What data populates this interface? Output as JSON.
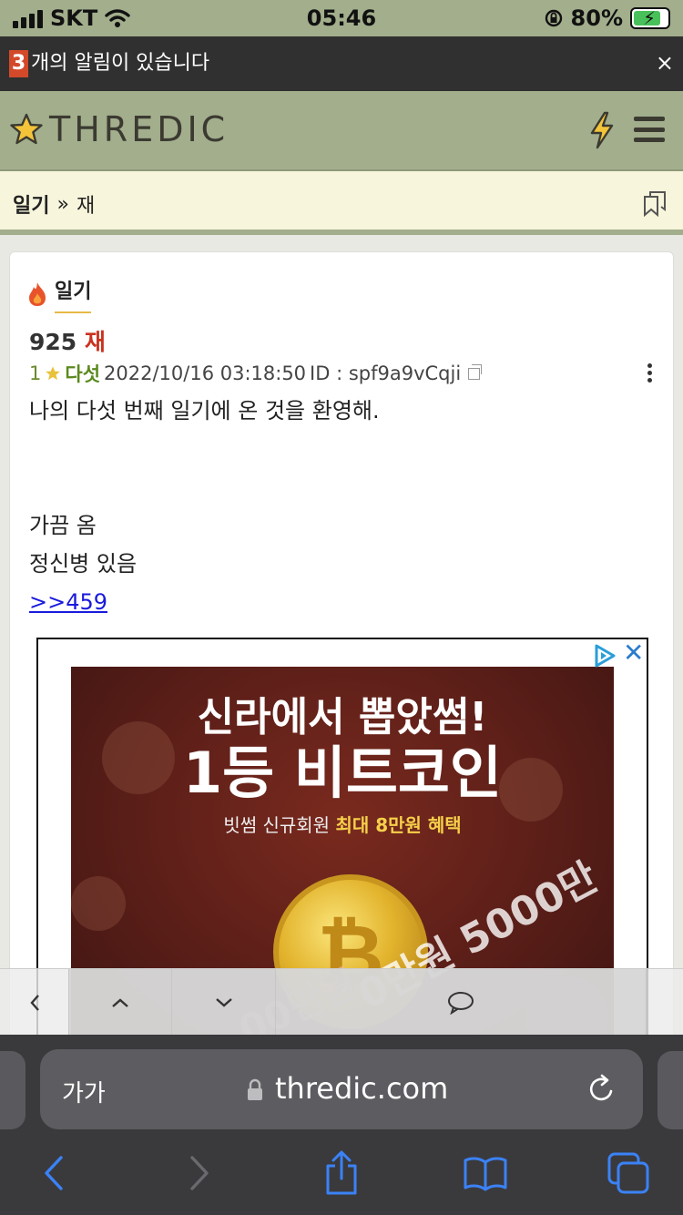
{
  "status_bar": {
    "carrier": "SKT",
    "time": "05:46",
    "battery_percent": "80%",
    "battery_level": 0.8
  },
  "notification": {
    "count": "3",
    "text": "개의 알림이 있습니다",
    "close": "×"
  },
  "header": {
    "logo_text": "THREDIC"
  },
  "breadcrumb": {
    "board": "일기",
    "separator": "»",
    "thread": "재"
  },
  "thread": {
    "board_label": "일기",
    "number": "925",
    "title": "재"
  },
  "post": {
    "number": "1",
    "author": "다섯",
    "datetime": "2022/10/16 03:18:50",
    "id_label": "ID : spf9a9vCqji",
    "lines": [
      "나의 다섯 번째 일기에 온 것을 환영해.",
      "",
      "",
      "가끔 옴",
      "정신병 있음"
    ],
    "link": ">>459"
  },
  "ad": {
    "headline_1": "신라에서 뽑았썸!",
    "headline_2": "1등 비트코인",
    "sub_prefix": "빗썸 신규회원",
    "sub_highlight": "최대 8만원 혜택",
    "stamp_1": "0만원 5000만",
    "stamp_2": "00만원"
  },
  "safari": {
    "text_size_label": "가가",
    "url": "thredic.com"
  },
  "colors": {
    "header_bg": "#a2ae8c",
    "breadcrumb_bg": "#f7f5dc",
    "title_accent": "#c9331f",
    "author_green": "#5b8a1e",
    "link_blue": "#1a1add",
    "safari_bg": "#3a3a3d",
    "safari_icon_blue": "#3b82f6"
  }
}
